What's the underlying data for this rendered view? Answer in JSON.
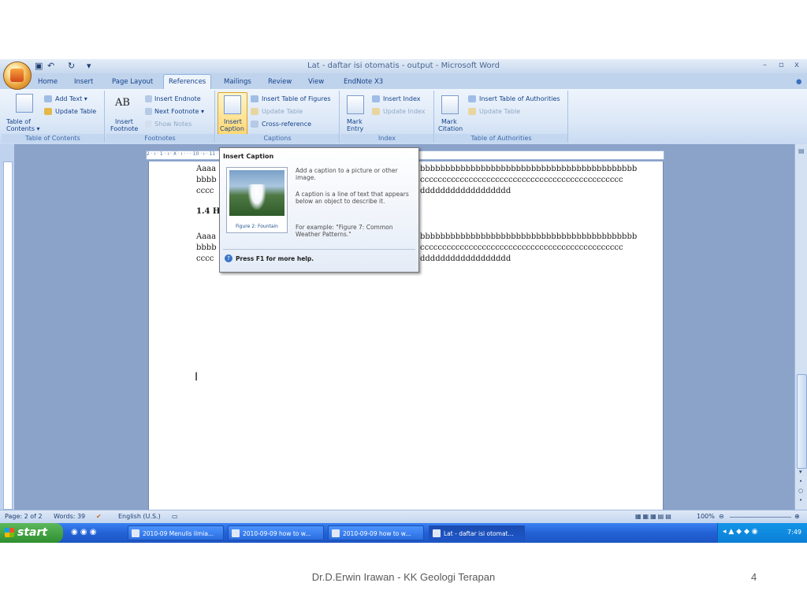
{
  "window": {
    "title": "Lat - daftar isi otomatis - output - Microsoft Word",
    "controls": [
      "–",
      "▫",
      "x"
    ]
  },
  "tabs": [
    "Home",
    "Insert",
    "Page Layout",
    "References",
    "Mailings",
    "Review",
    "View",
    "EndNote X3"
  ],
  "active_tab": "References",
  "ribbon": {
    "toc": {
      "add_text": "Add Text ▾",
      "update_table": "Update Table",
      "table_of": "Table of",
      "contents": "Contents ▾",
      "label": "Table of Contents"
    },
    "footnotes": {
      "insert_endnote": "Insert Endnote",
      "next_footnote": "Next Footnote ▾",
      "show_notes": "Show Notes",
      "insert": "Insert",
      "footnote": "Footnote",
      "ab_glyph": "AB",
      "label": "Footnotes"
    },
    "captions": {
      "insert": "Insert",
      "caption": "Caption",
      "insert_table_of_figures": "Insert Table of Figures",
      "update_table": "Update Table",
      "cross_reference": "Cross-reference",
      "label": "Captions"
    },
    "index": {
      "mark": "Mark",
      "entry": "Entry",
      "insert_index": "Insert Index",
      "update_index": "Update Index",
      "label": "Index"
    },
    "authorities": {
      "mark": "Mark",
      "citation": "Citation",
      "insert_table_of_authorities": "Insert Table of Authorities",
      "update_table": "Update Table",
      "label": "Table of Authorities"
    }
  },
  "ruler_text": "2 · ı · 1 · ı · X · ı · ·                                                              · 10 · ı · 11 · ı · 12 · ı · 13 · ı · 14 · ı · 15 · ı · 16 · ı · 17 · ı · · ı · 19 · ı",
  "document": {
    "lines": [
      "Aaaa",
      "bbbb",
      "cccc",
      "1.4 H",
      "Aaaa",
      "bbbb",
      "cccc"
    ],
    "right_lines": [
      "bbbbbbbbbbbbbbbbbbbbbbbbbbbbbbbbbbbbbbbbbbb",
      "cccccccccccccccccccccccccccccccccccccccccccccc",
      "dddddddddddddddddd",
      "bbbbbbbbbbbbbbbbbbbbbbbbbbbbbbbbbbbbbbbbbbb",
      "cccccccccccccccccccccccccccccccccccccccccccccc",
      "dddddddddddddddddd"
    ],
    "cursor": "I"
  },
  "tooltip": {
    "title": "Insert Caption",
    "image_caption": "Figure 2: Fountain",
    "p1": "Add a caption to a picture or other image.",
    "p2": "A caption is a line of text that appears below an object to describe it.",
    "p3": "For example: \"Figure 7: Common Weather Patterns.\"",
    "help": "Press F1 for more help."
  },
  "status": {
    "page": "Page: 2 of 2",
    "words": "Words: 39",
    "language": "English (U.S.)",
    "zoom": "100%"
  },
  "taskbar": {
    "start": "start",
    "items": [
      "2010-09 Menulis ilmia...",
      "2010-09-09 how to w...",
      "2010-09-09 how to w...",
      "Lat - daftar isi otomat..."
    ],
    "clock": "7:49"
  },
  "footer": {
    "text": "Dr.D.Erwin Irawan - KK Geologi Terapan",
    "page": "4"
  },
  "colors": {
    "ribbon_blue": "#15428b",
    "taskbar_blue": "#2262d6",
    "start_green": "#3c9e3c"
  }
}
